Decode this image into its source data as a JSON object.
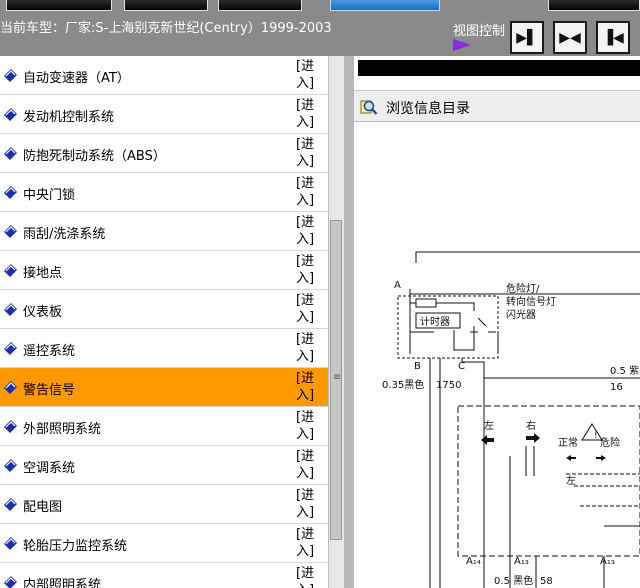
{
  "header": {
    "current_model": "当前车型：厂家:S-上海别克新世纪(Centry）1999-2003",
    "view_control": "视图控制"
  },
  "view_buttons": [
    {
      "name": "dock-right-icon",
      "glyph": "▶▌"
    },
    {
      "name": "split-view-icon",
      "glyph": "▶◀"
    },
    {
      "name": "dock-left-icon",
      "glyph": "▐◀"
    }
  ],
  "sidebar": {
    "enter_label": "[进入]",
    "items": [
      {
        "label": "自动变速器（AT）"
      },
      {
        "label": "发动机控制系统"
      },
      {
        "label": "防抱死制动系统（ABS）"
      },
      {
        "label": "中央门锁"
      },
      {
        "label": "雨刮/洗涤系统"
      },
      {
        "label": "接地点"
      },
      {
        "label": "仪表板"
      },
      {
        "label": "遥控系统"
      },
      {
        "label": "警告信号",
        "selected": true
      },
      {
        "label": "外部照明系统"
      },
      {
        "label": "空调系统"
      },
      {
        "label": "配电图"
      },
      {
        "label": "轮胎压力监控系统"
      },
      {
        "label": "内部照明系统"
      }
    ]
  },
  "browse": {
    "title": "浏览信息目录"
  },
  "diagram": {
    "pin_a": "A",
    "pin_b": "B",
    "pin_c": "C",
    "flasher_title_1": "危险灯/",
    "flasher_title_2": "转向信号灯",
    "flasher_title_3": "闪光器",
    "timer_label": "计时器",
    "wire_left": "0.35黑色",
    "wire_left_no": "1750",
    "wire_right": "0.5 紫",
    "wire_right_no": "16",
    "left_label": "左",
    "right_label": "右",
    "normal_label": "正常",
    "hazard_label": "危险",
    "left_label_2": "左",
    "pin_a14": "A₁₄",
    "pin_a13": "A₁₃",
    "pin_a13b": "A₁₃",
    "bottom_wire": "0.5 黑色",
    "bottom_wire_no": "58"
  },
  "colors": {
    "selected_row": "#ff9900",
    "icon_blue": "#1a2fb0",
    "view_arrow": "#8a2be2"
  }
}
